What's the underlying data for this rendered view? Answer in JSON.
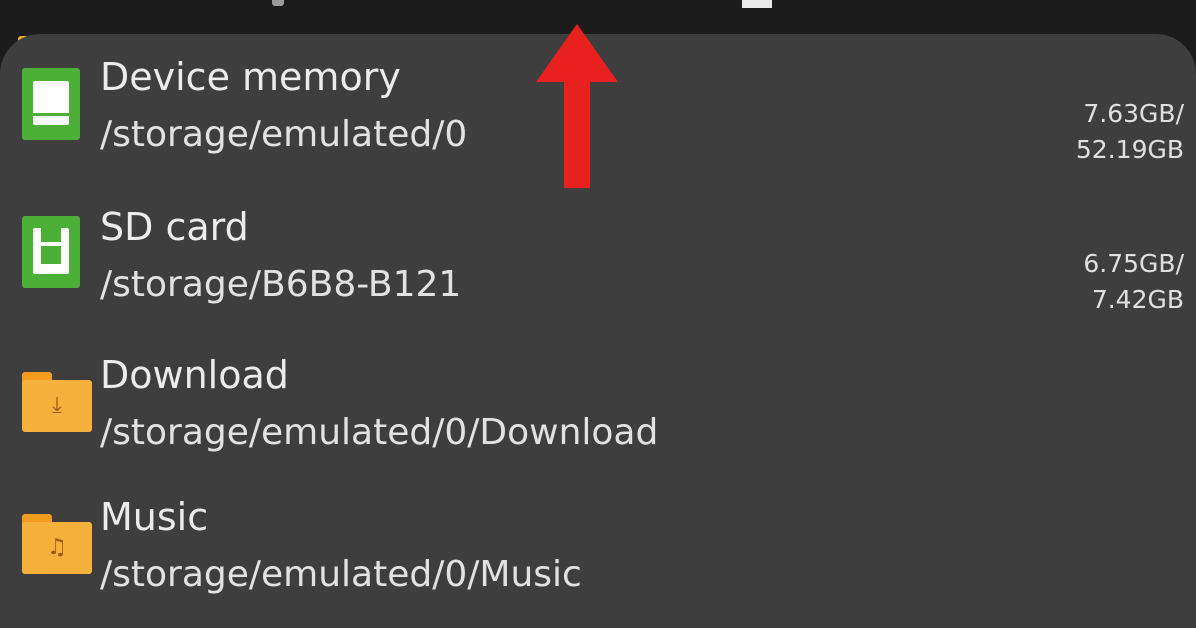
{
  "storage_list": [
    {
      "name": "Device memory",
      "path": "/storage/emulated/0",
      "size_line1": "7.63GB/",
      "size_line2": "52.19GB",
      "icon": "device-memory-icon"
    },
    {
      "name": "SD card",
      "path": "/storage/B6B8-B121",
      "size_line1": "6.75GB/",
      "size_line2": "7.42GB",
      "icon": "sd-card-icon"
    },
    {
      "name": "Download",
      "path": "/storage/emulated/0/Download",
      "icon": "download-folder-icon"
    },
    {
      "name": "Music",
      "path": "/storage/emulated/0/Music",
      "icon": "music-folder-icon"
    }
  ],
  "colors": {
    "dropdown_bg": "#3e3e3e",
    "storage_icon_green": "#4caf38",
    "folder_orange": "#f6b03c",
    "arrow_red": "#e8211f"
  },
  "icons": {
    "download_glyph": "⤓",
    "music_glyph": "♫"
  }
}
